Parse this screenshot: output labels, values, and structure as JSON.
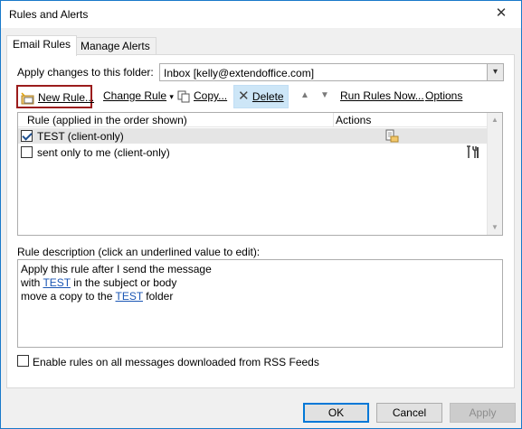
{
  "window": {
    "title": "Rules and Alerts"
  },
  "tabs": [
    {
      "label": "Email Rules",
      "active": true
    },
    {
      "label": "Manage Alerts",
      "active": false
    }
  ],
  "folder": {
    "label": "Apply changes to this folder:",
    "value": "Inbox [kelly@extendoffice.com]"
  },
  "toolbar": {
    "new_rule": "New Rule...",
    "change_rule": "Change Rule",
    "copy": "Copy...",
    "delete": "Delete",
    "run_rules": "Run Rules Now...",
    "options": "Options"
  },
  "rules_list": {
    "columns": [
      "Rule (applied in the order shown)",
      "Actions"
    ],
    "rows": [
      {
        "name": "TEST  (client-only)",
        "checked": true,
        "selected": true,
        "action_icon": "move-to-folder-icon"
      },
      {
        "name": "sent only to me  (client-only)",
        "checked": false,
        "selected": false,
        "action_icon": "tools-icon"
      }
    ]
  },
  "description": {
    "label": "Rule description (click an underlined value to edit):",
    "line1": "Apply this rule after I send the message",
    "line2_prefix": "with ",
    "line2_link": "TEST",
    "line2_suffix": " in the subject or body",
    "line3_prefix": "move a copy to the ",
    "line3_link": "TEST",
    "line3_suffix": " folder"
  },
  "rss": {
    "label": "Enable rules on all messages downloaded from RSS Feeds",
    "checked": false
  },
  "buttons": {
    "ok": "OK",
    "cancel": "Cancel",
    "apply": "Apply"
  },
  "colors": {
    "accent": "#0078d7",
    "highlight_border": "#9b1c1c",
    "link": "#1a56b4"
  }
}
